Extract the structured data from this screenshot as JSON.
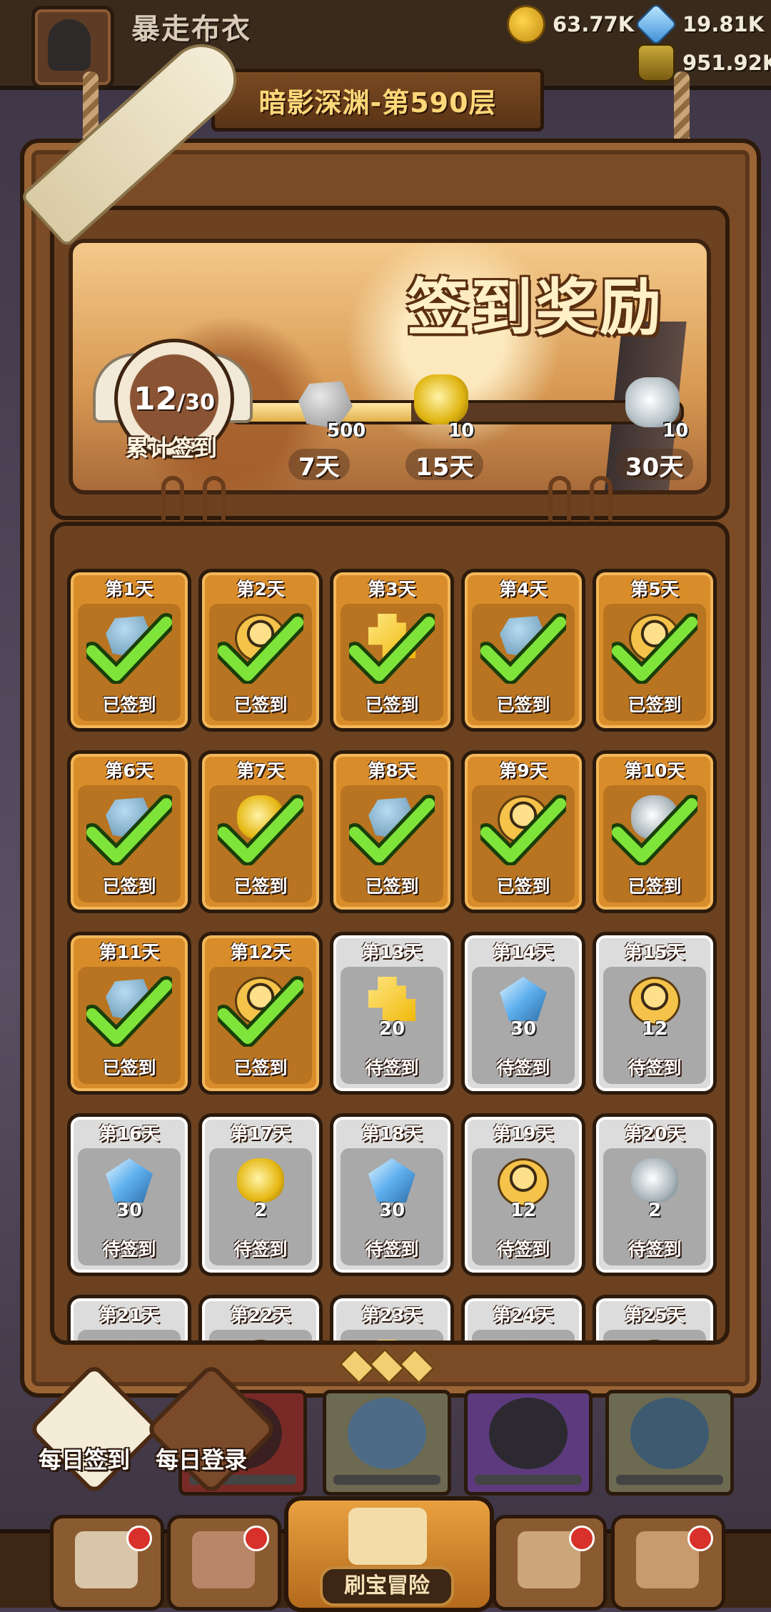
{
  "header": {
    "player_name": "暴走布衣",
    "gold": "63.77K",
    "gems": "19.81K",
    "potions": "951.92K",
    "layer": "暗影深渊-第590层"
  },
  "signin": {
    "title": "签到奖励",
    "progress_value": 12,
    "progress_total": 30,
    "progress_sep": "/",
    "progress_label": "累计签到",
    "milestones": [
      {
        "amount": "500",
        "day_label": "7天",
        "icon": "stone-icon"
      },
      {
        "amount": "10",
        "day_label": "15天",
        "icon": "gold-scroll-icon"
      },
      {
        "amount": "10",
        "day_label": "30天",
        "icon": "silver-scroll-icon"
      }
    ]
  },
  "days": [
    {
      "day": "第1天",
      "status": "已签到",
      "signed": true,
      "icon": "stone-icon",
      "amount": ""
    },
    {
      "day": "第2天",
      "status": "已签到",
      "signed": true,
      "icon": "hero-icon",
      "amount": ""
    },
    {
      "day": "第3天",
      "status": "已签到",
      "signed": true,
      "icon": "puzzle-icon",
      "amount": ""
    },
    {
      "day": "第4天",
      "status": "已签到",
      "signed": true,
      "icon": "stone-icon",
      "amount": ""
    },
    {
      "day": "第5天",
      "status": "已签到",
      "signed": true,
      "icon": "hero-icon",
      "amount": ""
    },
    {
      "day": "第6天",
      "status": "已签到",
      "signed": true,
      "icon": "stone-icon",
      "amount": ""
    },
    {
      "day": "第7天",
      "status": "已签到",
      "signed": true,
      "icon": "gold-scroll-icon",
      "amount": ""
    },
    {
      "day": "第8天",
      "status": "已签到",
      "signed": true,
      "icon": "stone-icon",
      "amount": ""
    },
    {
      "day": "第9天",
      "status": "已签到",
      "signed": true,
      "icon": "hero-icon",
      "amount": ""
    },
    {
      "day": "第10天",
      "status": "已签到",
      "signed": true,
      "icon": "silver-scroll-icon",
      "amount": ""
    },
    {
      "day": "第11天",
      "status": "已签到",
      "signed": true,
      "icon": "stone-icon",
      "amount": ""
    },
    {
      "day": "第12天",
      "status": "已签到",
      "signed": true,
      "icon": "hero-icon",
      "amount": ""
    },
    {
      "day": "第13天",
      "status": "待签到",
      "signed": false,
      "icon": "puzzle-icon",
      "amount": "20"
    },
    {
      "day": "第14天",
      "status": "待签到",
      "signed": false,
      "icon": "gem-icon",
      "amount": "30"
    },
    {
      "day": "第15天",
      "status": "待签到",
      "signed": false,
      "icon": "hero-icon",
      "amount": "12"
    },
    {
      "day": "第16天",
      "status": "待签到",
      "signed": false,
      "icon": "gem-icon",
      "amount": "30"
    },
    {
      "day": "第17天",
      "status": "待签到",
      "signed": false,
      "icon": "gold-scroll-icon",
      "amount": "2"
    },
    {
      "day": "第18天",
      "status": "待签到",
      "signed": false,
      "icon": "gem-icon",
      "amount": "30"
    },
    {
      "day": "第19天",
      "status": "待签到",
      "signed": false,
      "icon": "hero-icon",
      "amount": "12"
    },
    {
      "day": "第20天",
      "status": "待签到",
      "signed": false,
      "icon": "silver-scroll-icon",
      "amount": "2"
    },
    {
      "day": "第21天",
      "status": "",
      "signed": false,
      "icon": "gem-icon",
      "amount": ""
    },
    {
      "day": "第22天",
      "status": "",
      "signed": false,
      "icon": "hero-icon",
      "amount": ""
    },
    {
      "day": "第23天",
      "status": "",
      "signed": false,
      "icon": "puzzle-icon",
      "amount": ""
    },
    {
      "day": "第24天",
      "status": "",
      "signed": false,
      "icon": "gem-icon",
      "amount": ""
    },
    {
      "day": "第25天",
      "status": "",
      "signed": false,
      "icon": "hero-icon",
      "amount": ""
    }
  ],
  "side_buttons": {
    "daily_signin": "每日签到",
    "daily_login": "每日登录"
  },
  "nav": {
    "center_label": "刷宝冒险"
  }
}
